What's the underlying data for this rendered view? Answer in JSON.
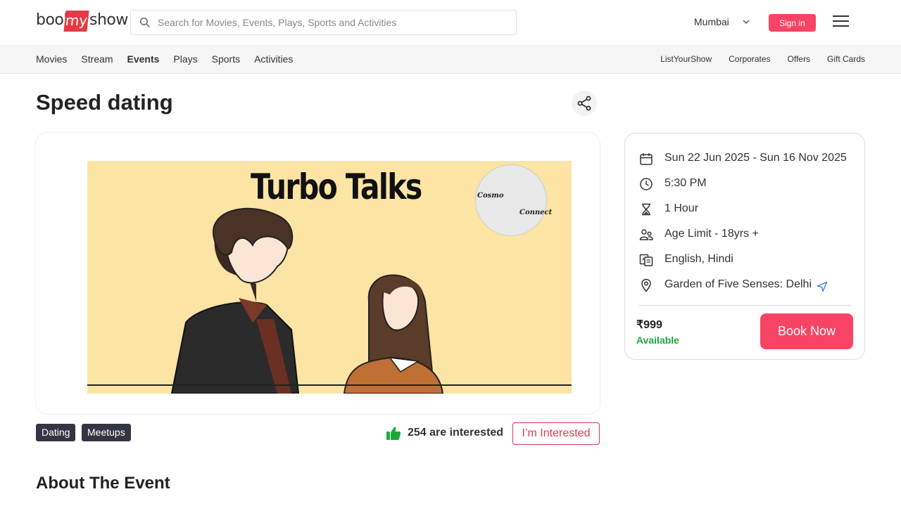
{
  "header": {
    "logo": {
      "part1": "book",
      "part2": "my",
      "part3": "show"
    },
    "search_placeholder": "Search for Movies, Events, Plays, Sports and Activities",
    "city": "Mumbai",
    "signin_label": "Sign in"
  },
  "subnav": {
    "left": [
      "Movies",
      "Stream",
      "Events",
      "Plays",
      "Sports",
      "Activities"
    ],
    "active": "Events",
    "right": [
      "ListYourShow",
      "Corporates",
      "Offers",
      "Gift Cards"
    ]
  },
  "event": {
    "title": "Speed dating",
    "poster_title": "Turbo Talks",
    "poster_logo_text1": "Cosmo",
    "poster_logo_text2": "Connect",
    "tags": [
      "Dating",
      "Meetups"
    ],
    "interested_text": "254 are interested",
    "interest_button": "I’m Interested",
    "about_heading": "About The Event"
  },
  "card": {
    "date": "Sun 22 Jun 2025 - Sun 16 Nov 2025",
    "time": "5:30 PM",
    "duration": "1 Hour",
    "age_limit": "Age Limit - 18yrs +",
    "language": "English, Hindi",
    "venue": "Garden of Five Senses: Delhi",
    "price": "₹999",
    "availability": "Available",
    "book_label": "Book Now"
  },
  "colors": {
    "brand": "#f84464",
    "available": "#1ea83c",
    "tag_bg": "#333545",
    "poster_bg": "#fbe4a4"
  }
}
